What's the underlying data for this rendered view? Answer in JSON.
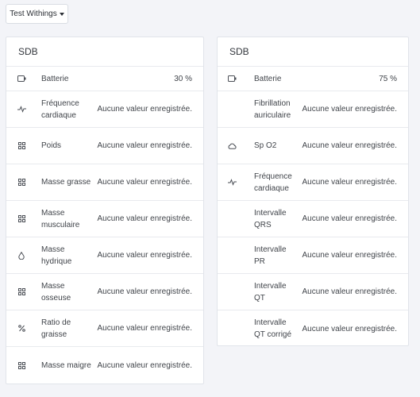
{
  "dropdown": {
    "label": "Test Withings"
  },
  "cards": [
    {
      "title": "SDB",
      "rows": [
        {
          "icon": "battery-icon",
          "label": "Batterie",
          "value": "30 %"
        },
        {
          "icon": "heartbeat-icon",
          "label": "Fréquence cardiaque",
          "value": "Aucune valeur enregistrée."
        },
        {
          "icon": "grid-icon",
          "label": "Poids",
          "value": "Aucune valeur enregistrée."
        },
        {
          "icon": "grid-icon",
          "label": "Masse grasse",
          "value": "Aucune valeur enregistrée."
        },
        {
          "icon": "grid-icon",
          "label": "Masse musculaire",
          "value": "Aucune valeur enregistrée."
        },
        {
          "icon": "drop-icon",
          "label": "Masse hydrique",
          "value": "Aucune valeur enregistrée."
        },
        {
          "icon": "grid-icon",
          "label": "Masse osseuse",
          "value": "Aucune valeur enregistrée."
        },
        {
          "icon": "percent-icon",
          "label": "Ratio de graisse",
          "value": "Aucune valeur enregistrée."
        },
        {
          "icon": "grid-icon",
          "label": "Masse maigre",
          "value": "Aucune valeur enregistrée."
        }
      ]
    },
    {
      "title": "SDB",
      "rows": [
        {
          "icon": "battery-icon",
          "label": "Batterie",
          "value": "75 %"
        },
        {
          "icon": "",
          "label": "Fibrillation auriculaire",
          "value": "Aucune valeur enregistrée."
        },
        {
          "icon": "cloud-icon",
          "label": "Sp O2",
          "value": "Aucune valeur enregistrée."
        },
        {
          "icon": "heartbeat-icon",
          "label": "Fréquence cardiaque",
          "value": "Aucune valeur enregistrée."
        },
        {
          "icon": "",
          "label": "Intervalle QRS",
          "value": "Aucune valeur enregistrée."
        },
        {
          "icon": "",
          "label": "Intervalle PR",
          "value": "Aucune valeur enregistrée."
        },
        {
          "icon": "",
          "label": "Intervalle QT",
          "value": "Aucune valeur enregistrée."
        },
        {
          "icon": "",
          "label": "Intervalle QT corrigé",
          "value": "Aucune valeur enregistrée."
        }
      ]
    }
  ]
}
